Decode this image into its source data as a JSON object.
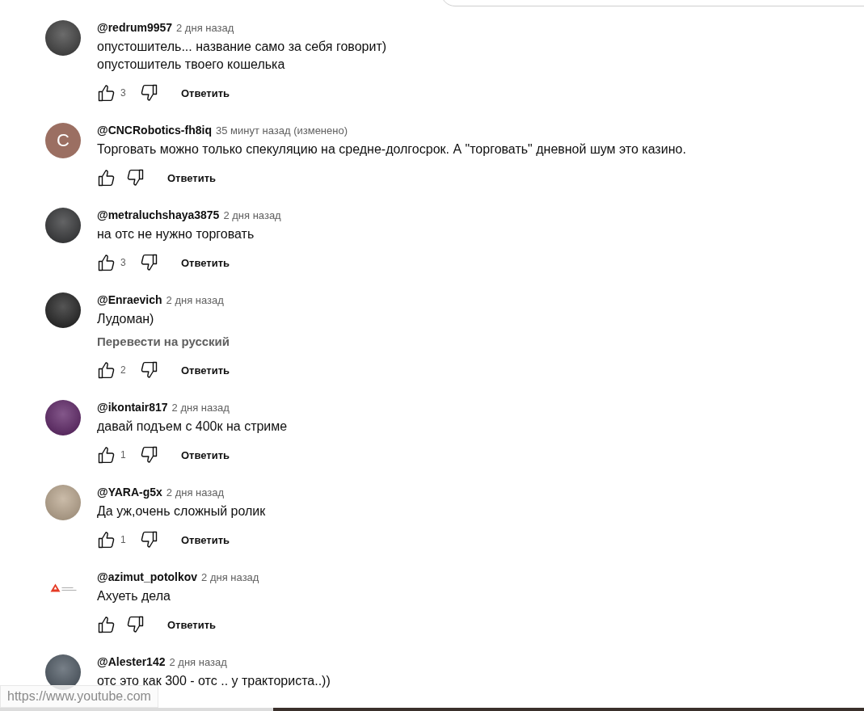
{
  "comments": [
    {
      "author": "@redrum9957",
      "time": "2 дня назад",
      "avatar": {
        "kind": "photo",
        "color": "#3a3a3a"
      },
      "lines": [
        "опустошитель... название само за себя говорит)",
        "опустошитель твоего кошелька"
      ],
      "likes": "3",
      "reply": "Ответить"
    },
    {
      "author": "@CNCRobotics-fh8iq",
      "time": "35 минут назад (изменено)",
      "avatar": {
        "kind": "letter",
        "letter": "C",
        "color": "#9b6f62"
      },
      "lines": [
        "Торговать можно только спекуляцию на средне-долгосрок. А \"торговать\" дневной шум это казино."
      ],
      "reply": "Ответить"
    },
    {
      "author": "@metraluchshaya3875",
      "time": "2 дня назад",
      "avatar": {
        "kind": "photo",
        "color": "#2f3032"
      },
      "lines": [
        "на отс не нужно торговать"
      ],
      "likes": "3",
      "reply": "Ответить"
    },
    {
      "author": "@Enraevich",
      "time": "2 дня назад",
      "avatar": {
        "kind": "photo",
        "color": "#1c1c1c"
      },
      "lines": [
        "Лудоман)"
      ],
      "translate": "Перевести на русский",
      "likes": "2",
      "reply": "Ответить"
    },
    {
      "author": "@ikontair817",
      "time": "2 дня назад",
      "avatar": {
        "kind": "photo",
        "color": "#5a1f63"
      },
      "lines": [
        "давай подъем с 400к на стриме"
      ],
      "likes": "1",
      "reply": "Ответить"
    },
    {
      "author": "@YARA-g5x",
      "time": "2 дня назад",
      "avatar": {
        "kind": "photo",
        "color": "#b9a58c"
      },
      "lines": [
        "Да уж,очень сложный ролик"
      ],
      "likes": "1",
      "reply": "Ответить"
    },
    {
      "author": "@azimut_potolkov",
      "time": "2 дня назад",
      "avatar": {
        "kind": "logo",
        "color": "#ffffff"
      },
      "lines": [
        "Ахуеть дела"
      ],
      "reply": "Ответить"
    },
    {
      "author": "@Alester142",
      "time": "2 дня назад",
      "avatar": {
        "kind": "photo",
        "color": "#4a5560"
      },
      "lines": [
        "отс это как 300 - отс .. у тракториста..))"
      ]
    }
  ],
  "status_url": "https://www.youtube.com"
}
